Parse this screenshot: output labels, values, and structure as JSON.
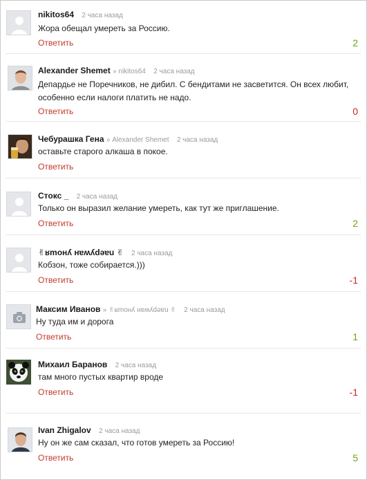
{
  "colors": {
    "reply_link": "#c0392b",
    "positive": "#6aa515",
    "negative": "#cc2222",
    "meta": "#9a9a9a"
  },
  "comments": [
    {
      "author": "nikitos64",
      "reply_to": "",
      "time": "2 часа назад",
      "text": "Жора обещал умереть за Россию.",
      "reply_label": "Ответить",
      "score": "2",
      "score_sign": "positive",
      "avatar": "default-avatar"
    },
    {
      "author": "Alexander Shemet",
      "reply_to": "» nikitos64",
      "time": "2 часа назад",
      "text": "Депардье не Поречников, не дибил. С бендитами не засветится. Он всех любит, особенно если налоги платить не надо.",
      "reply_label": "Ответить",
      "score": "0",
      "score_sign": "negative",
      "avatar": "photo-man-avatar"
    },
    {
      "author": "Чебурашка Гена",
      "reply_to": "» Alexander Shemet",
      "time": "2 часа назад",
      "text": "оставьте старого алкаша в покое.",
      "reply_label": "Ответить",
      "score": "",
      "score_sign": "",
      "avatar": "photo-drinking-avatar"
    },
    {
      "author": "Стокс _",
      "reply_to": "",
      "time": "2 часа назад",
      "text": "Только он выразил желание умереть, как тут же приглашение.",
      "reply_label": "Ответить",
      "score": "2",
      "score_sign": "positive",
      "avatar": "default-avatar"
    },
    {
      "author": "✌ʁmонʎ нɐʍʎdəɐu ✌",
      "reply_to": "",
      "time": "2 часа назад",
      "text": "Кобзон, тоже собирается.)))",
      "reply_label": "Ответить",
      "score": "-1",
      "score_sign": "negative",
      "avatar": "default-avatar"
    },
    {
      "author": "Максим Иванов",
      "reply_to": "» ✌ʁmонʎ нɐʍʎdəɐu ✌",
      "time": "2 часа назад",
      "text": "Ну туда им и дорога",
      "reply_label": "Ответить",
      "score": "1",
      "score_sign": "positive",
      "avatar": "camera-avatar"
    },
    {
      "author": "Михаил Баранов",
      "reply_to": "",
      "time": "2 часа назад",
      "text": "там много пустых квартир вроде",
      "reply_label": "Ответить",
      "score": "-1",
      "score_sign": "negative",
      "avatar": "panda-avatar"
    },
    {
      "author": "Ivan Zhigalov",
      "reply_to": "",
      "time": "2 часа назад",
      "text": "Ну он же сам сказал, что готов умереть за Россию!",
      "reply_label": "Ответить",
      "score": "5",
      "score_sign": "positive",
      "avatar": "photo-young-man-avatar"
    }
  ]
}
